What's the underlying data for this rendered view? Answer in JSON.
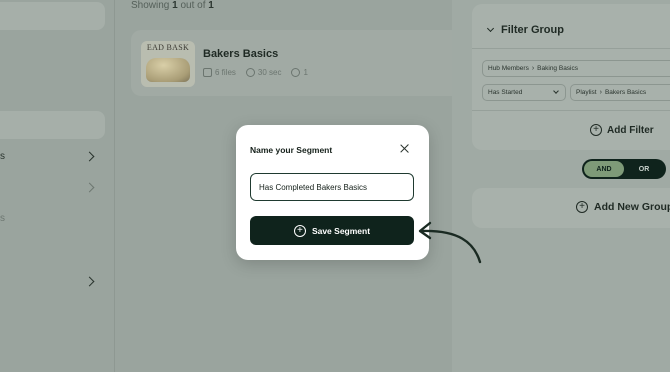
{
  "left_sidebar": {
    "items": [
      {
        "label": "s",
        "faded": false
      },
      {
        "label": "",
        "faded": true
      },
      {
        "label": "s",
        "faded": true
      },
      {
        "label": "",
        "faded": false
      }
    ]
  },
  "results": {
    "showing_prefix": "Showing ",
    "showing_count": "1",
    "showing_mid": " out of ",
    "showing_total": "1"
  },
  "playlist_card": {
    "thumbnail_text": "EAD BASK",
    "title": "Bakers Basics",
    "files": "6 files",
    "duration": "30 sec",
    "count": "1"
  },
  "filter_panel": {
    "group_title": "Filter Group",
    "hub_members_chip": {
      "part1": "Hub Members",
      "part2": "Baking Basics"
    },
    "status_select": "Has Started",
    "playlist_chip": {
      "part1": "Playlist",
      "part2": "Bakers Basics"
    },
    "add_filter_label": "Add Filter",
    "logic": {
      "and_label": "AND",
      "or_label": "OR",
      "selected": "AND"
    },
    "add_group_label": "Add New Group"
  },
  "modal": {
    "title": "Name your Segment",
    "input_value": "Has Completed Bakers Basics",
    "save_label": "Save Segment"
  },
  "colors": {
    "primary_dark": "#0f231c",
    "overlay": "#97a19b",
    "and_active": "#7e9a78"
  }
}
